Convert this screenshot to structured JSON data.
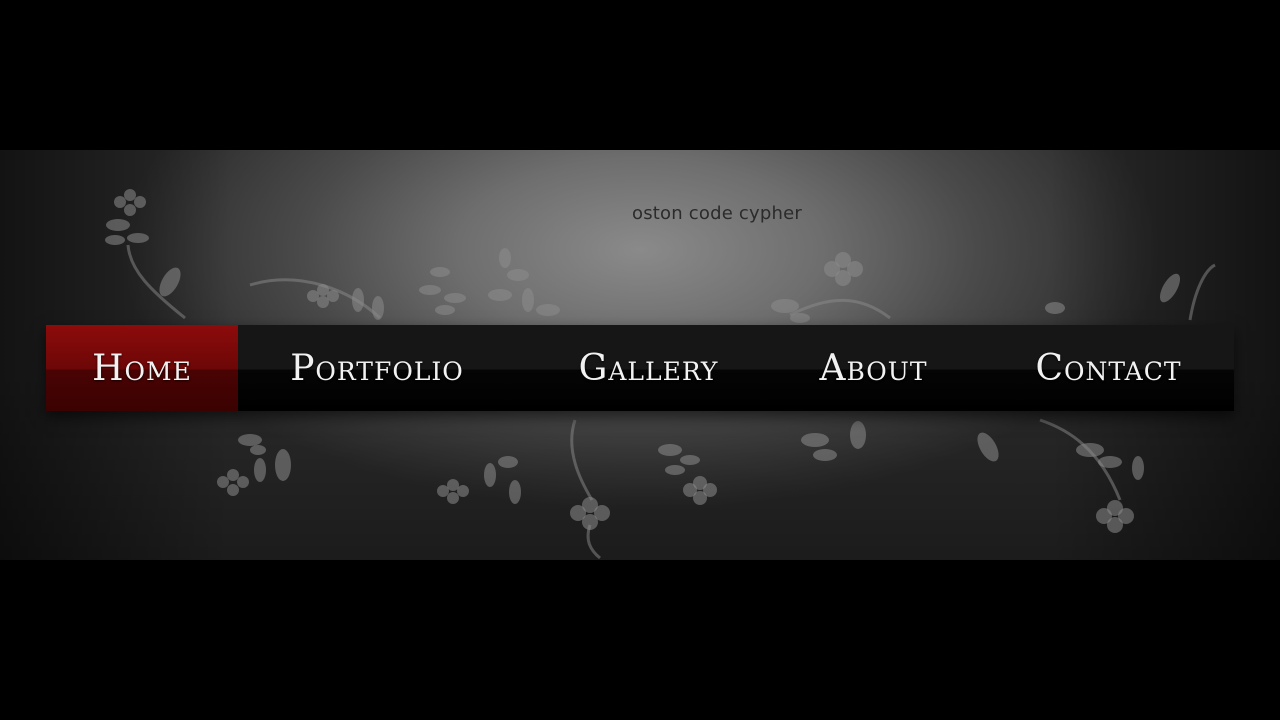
{
  "banner": {
    "tagline": "oston code cypher"
  },
  "nav": {
    "items": [
      {
        "label": "Home",
        "active": true
      },
      {
        "label": "Portfolio",
        "active": false
      },
      {
        "label": "Gallery",
        "active": false
      },
      {
        "label": "About",
        "active": false
      },
      {
        "label": "Contact",
        "active": false
      }
    ],
    "active_color": "#7a0a0a",
    "bar_color": "#111111",
    "text_color": "#f2f2f2"
  }
}
